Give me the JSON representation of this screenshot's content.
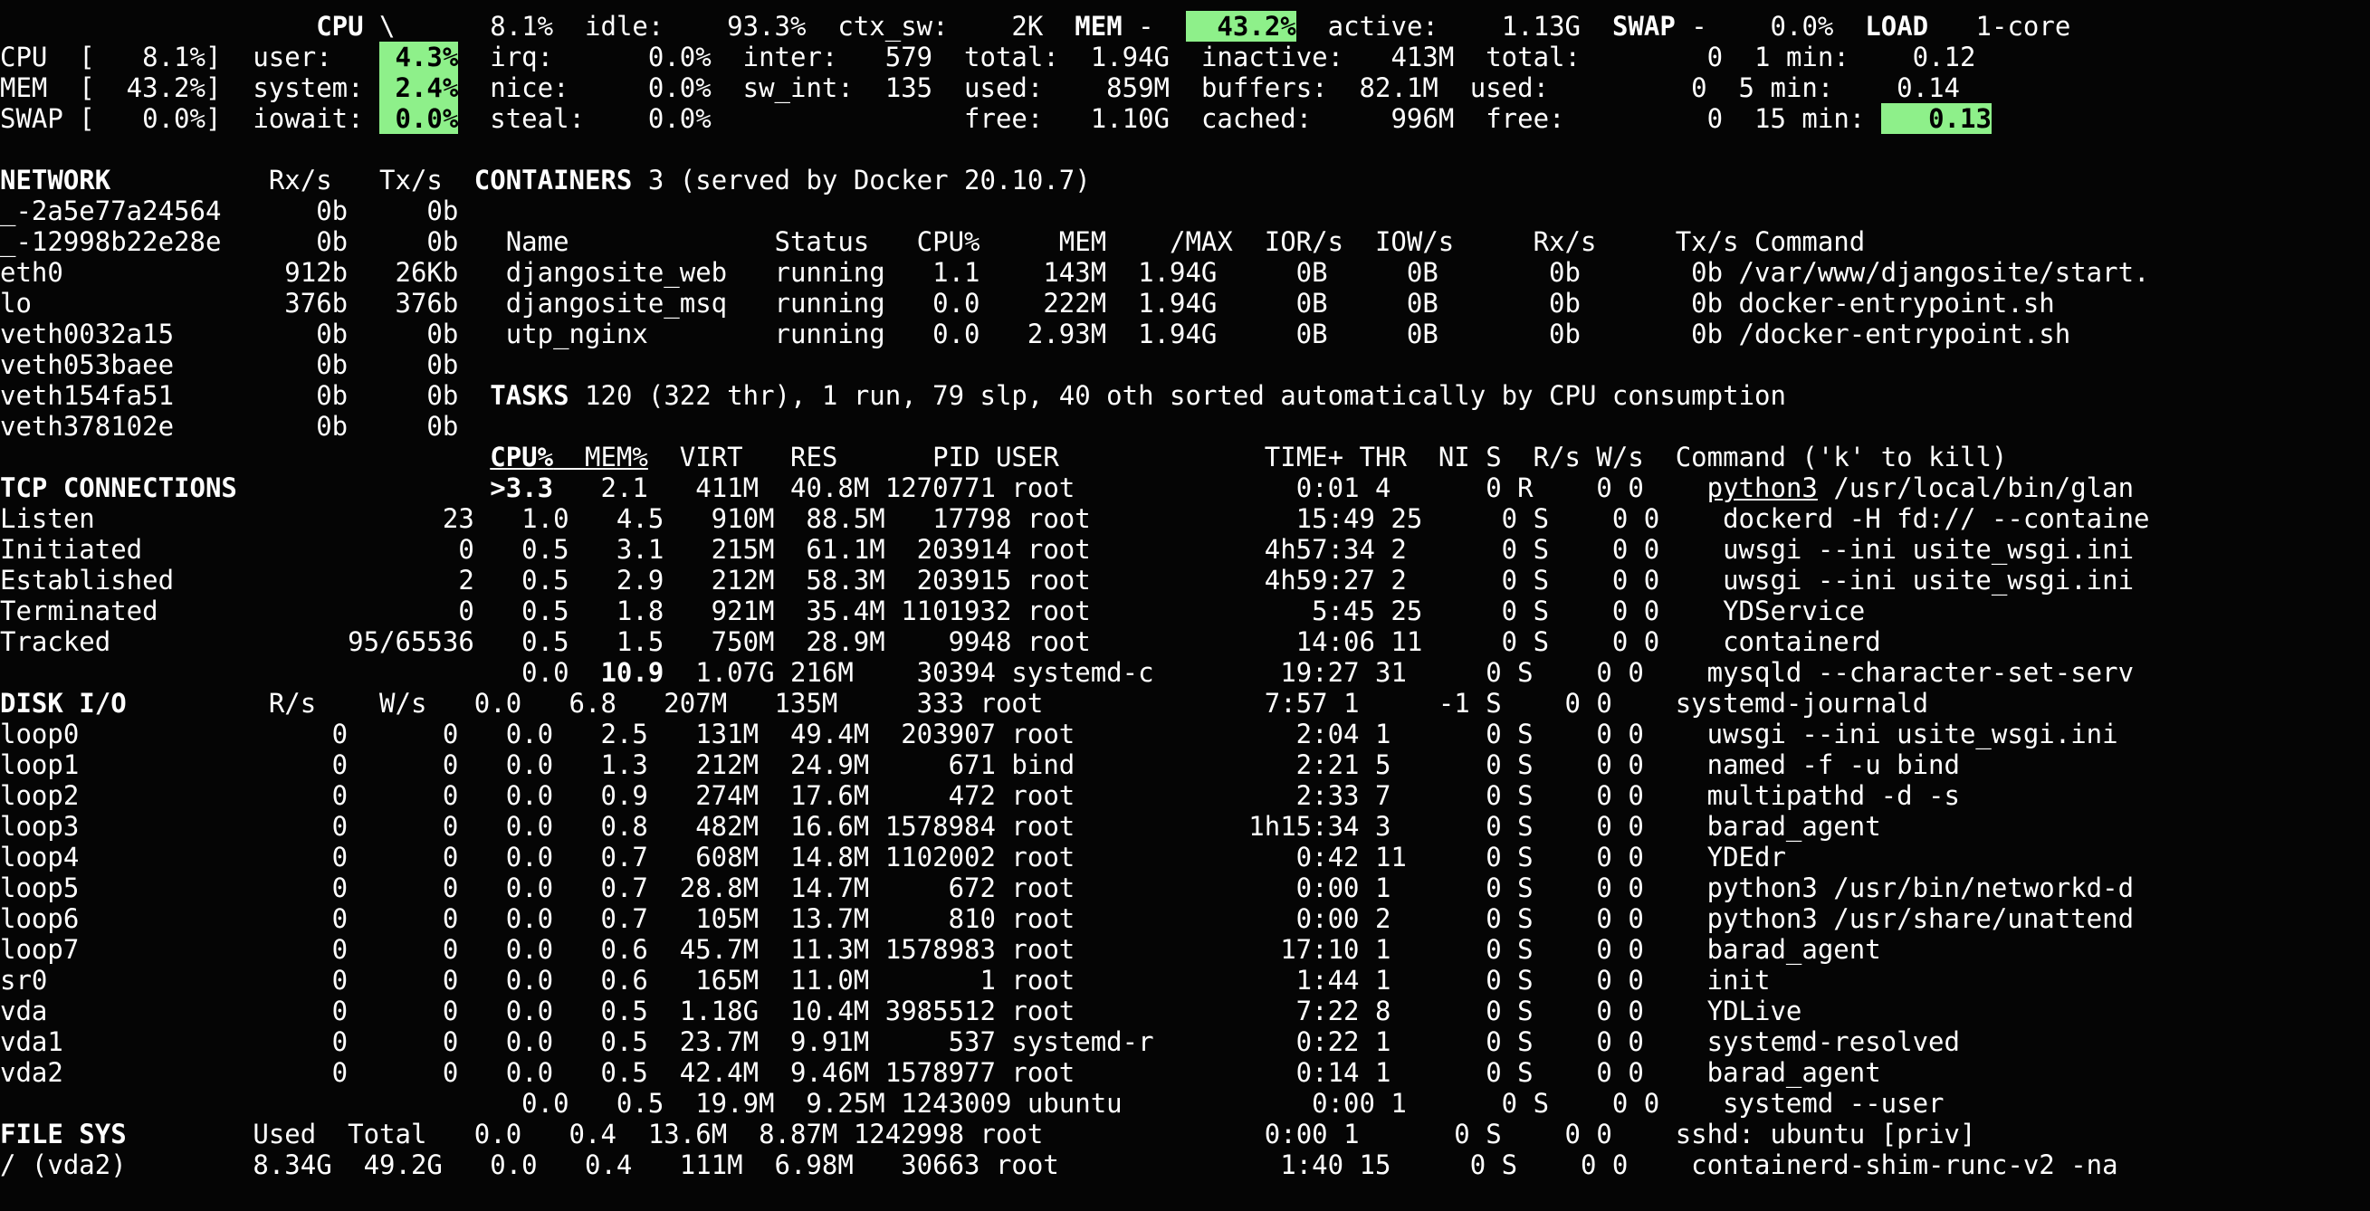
{
  "colors": {
    "background": "#050505",
    "text": "#ffffff",
    "highlight": "#8ef08a"
  },
  "lines": [
    {
      "id": "l00",
      "segs": [
        {
          "t": "                    "
        },
        {
          "t": "CPU",
          "name": "cpu-section-header",
          "c": "b"
        },
        {
          "t": " \\      8.1%  idle:    93.3%  ctx_sw:    2K  "
        },
        {
          "t": "MEM",
          "name": "mem-section-header",
          "c": "b"
        },
        {
          "t": " -  "
        },
        {
          "t": "  43.2%",
          "name": "mem-percent-value",
          "c": "hl b"
        },
        {
          "t": "  active:    1.13G  "
        },
        {
          "t": "SWAP",
          "name": "swap-section-header",
          "c": "b"
        },
        {
          "t": " -    0.0%  "
        },
        {
          "t": "LOAD",
          "name": "load-section-header",
          "c": "b"
        },
        {
          "t": "   1-core"
        }
      ]
    },
    {
      "id": "l01",
      "segs": [
        {
          "t": "CPU  [   8.1%]  user:   "
        },
        {
          "t": " 4.3%",
          "name": "cpu-user-value",
          "c": "hl b"
        },
        {
          "t": "  irq:      0.0%  inter:   579  total:  1.94G  inactive:   413M  total:        0  1 min:    0.12"
        }
      ]
    },
    {
      "id": "l02",
      "segs": [
        {
          "t": "MEM  [  43.2%]  system: "
        },
        {
          "t": " 2.4%",
          "name": "cpu-system-value",
          "c": "hl b"
        },
        {
          "t": "  nice:     0.0%  sw_int:  135  used:    859M  buffers:  82.1M  used:         0  5 min:    0.14"
        }
      ]
    },
    {
      "id": "l03",
      "segs": [
        {
          "t": "SWAP [   0.0%]  iowait: "
        },
        {
          "t": " 0.0%",
          "name": "cpu-iowait-value",
          "c": "hl b"
        },
        {
          "t": "  steal:    0.0%                free:   1.10G  cached:     996M  free:         0  15 min: "
        },
        {
          "t": "   0.13",
          "name": "load-15min-value",
          "c": "hl b"
        }
      ]
    },
    {
      "id": "l04",
      "segs": [
        {
          "t": ""
        }
      ]
    },
    {
      "id": "l05",
      "segs": [
        {
          "t": "NETWORK",
          "name": "network-section-header",
          "c": "b"
        },
        {
          "t": "          Rx/s   Tx/s  "
        },
        {
          "t": "CONTAINERS",
          "name": "containers-section-header",
          "c": "b"
        },
        {
          "t": " 3 (served by Docker 20.10.7)"
        }
      ]
    },
    {
      "id": "l06",
      "segs": [
        {
          "t": "_-2a5e77a24564      0b     0b"
        }
      ]
    },
    {
      "id": "l07",
      "segs": [
        {
          "t": "_-12998b22e28e      0b     0b   Name             Status   CPU%     MEM    /MAX  IOR/s  IOW/s     Rx/s     Tx/s Command"
        }
      ]
    },
    {
      "id": "l08",
      "segs": [
        {
          "t": "eth0              912b   26Kb   djangosite_web   running   1.1    143M  1.94G     0B     0B       0b       0b /var/www/djangosite/start."
        }
      ]
    },
    {
      "id": "l09",
      "segs": [
        {
          "t": "lo                376b   376b   djangosite_msq   running   0.0    222M  1.94G     0B     0B       0b       0b docker-entrypoint.sh"
        }
      ]
    },
    {
      "id": "l10",
      "segs": [
        {
          "t": "veth0032a15         0b     0b   utp_nginx        running   0.0   2.93M  1.94G     0B     0B       0b       0b /docker-entrypoint.sh"
        }
      ]
    },
    {
      "id": "l11",
      "segs": [
        {
          "t": "veth053baee         0b     0b"
        }
      ]
    },
    {
      "id": "l12",
      "segs": [
        {
          "t": "veth154fa51         0b     0b  "
        },
        {
          "t": "TASKS",
          "name": "tasks-section-header",
          "c": "b"
        },
        {
          "t": " 120 (322 thr), 1 run, 79 slp, 40 oth sorted automatically by CPU consumption"
        }
      ]
    },
    {
      "id": "l13",
      "segs": [
        {
          "t": "veth378102e         0b     0b"
        }
      ]
    },
    {
      "id": "l14",
      "segs": [
        {
          "t": "                               "
        },
        {
          "t": "CPU%",
          "name": "col-cpu-sort",
          "c": "b u"
        },
        {
          "t": "  MEM%",
          "c": "u"
        },
        {
          "t": "  VIRT   RES      PID USER             TIME+ THR  NI S  R/s W/s  Command ('k' to kill)"
        }
      ]
    },
    {
      "id": "l15",
      "segs": [
        {
          "t": "TCP CONNECTIONS",
          "name": "tcp-section-header",
          "c": "b"
        },
        {
          "t": "                "
        },
        {
          "t": ">3.3",
          "name": "top-cpu-value",
          "c": "b"
        },
        {
          "t": "   2.1   411M  40.8M 1270771 root              0:01 4      0 R    0 0    "
        },
        {
          "t": "python3",
          "c": "u"
        },
        {
          "t": " /usr/local/bin/glan"
        }
      ]
    },
    {
      "id": "l16",
      "segs": [
        {
          "t": "Listen                      23   1.0   4.5   910M  88.5M   17798 root             15:49 25     0 S    0 0    dockerd -H fd:// --containe"
        }
      ]
    },
    {
      "id": "l17",
      "segs": [
        {
          "t": "Initiated                    0   0.5   3.1   215M  61.1M  203914 root           4h57:34 2      0 S    0 0    uwsgi --ini usite_wsgi.ini"
        }
      ]
    },
    {
      "id": "l18",
      "segs": [
        {
          "t": "Established                  2   0.5   2.9   212M  58.3M  203915 root           4h59:27 2      0 S    0 0    uwsgi --ini usite_wsgi.ini"
        }
      ]
    },
    {
      "id": "l19",
      "segs": [
        {
          "t": "Terminated                   0   0.5   1.8   921M  35.4M 1101932 root              5:45 25     0 S    0 0    YDService"
        }
      ]
    },
    {
      "id": "l20",
      "segs": [
        {
          "t": "Tracked               95/65536   0.5   1.5   750M  28.9M    9948 root             14:06 11     0 S    0 0    containerd"
        }
      ]
    },
    {
      "id": "l21",
      "segs": [
        {
          "t": "                                 0.0  "
        },
        {
          "t": "10.9",
          "name": "top-mem-value",
          "c": "b"
        },
        {
          "t": "  1.07G 216M    30394 systemd-c        19:27 31     0 S    0 0    mysqld --character-set-serv"
        }
      ]
    },
    {
      "id": "l22",
      "segs": [
        {
          "t": "DISK I/O",
          "name": "disk-section-header",
          "c": "b"
        },
        {
          "t": "         R/s    W/s   0.0   6.8   207M   135M     333 root              7:57 1     -1 S    0 0    systemd-journald"
        }
      ]
    },
    {
      "id": "l23",
      "segs": [
        {
          "t": "loop0                0      0   0.0   2.5   131M  49.4M  203907 root              2:04 1      0 S    0 0    uwsgi --ini usite_wsgi.ini"
        }
      ]
    },
    {
      "id": "l24",
      "segs": [
        {
          "t": "loop1                0      0   0.0   1.3   212M  24.9M     671 bind              2:21 5      0 S    0 0    named -f -u bind"
        }
      ]
    },
    {
      "id": "l25",
      "segs": [
        {
          "t": "loop2                0      0   0.0   0.9   274M  17.6M     472 root              2:33 7      0 S    0 0    multipathd -d -s"
        }
      ]
    },
    {
      "id": "l26",
      "segs": [
        {
          "t": "loop3                0      0   0.0   0.8   482M  16.6M 1578984 root           1h15:34 3      0 S    0 0    barad_agent"
        }
      ]
    },
    {
      "id": "l27",
      "segs": [
        {
          "t": "loop4                0      0   0.0   0.7   608M  14.8M 1102002 root              0:42 11     0 S    0 0    YDEdr"
        }
      ]
    },
    {
      "id": "l28",
      "segs": [
        {
          "t": "loop5                0      0   0.0   0.7  28.8M  14.7M     672 root              0:00 1      0 S    0 0    python3 /usr/bin/networkd-d"
        }
      ]
    },
    {
      "id": "l29",
      "segs": [
        {
          "t": "loop6                0      0   0.0   0.7   105M  13.7M     810 root              0:00 2      0 S    0 0    python3 /usr/share/unattend"
        }
      ]
    },
    {
      "id": "l30",
      "segs": [
        {
          "t": "loop7                0      0   0.0   0.6  45.7M  11.3M 1578983 root             17:10 1      0 S    0 0    barad_agent"
        }
      ]
    },
    {
      "id": "l31",
      "segs": [
        {
          "t": "sr0                  0      0   0.0   0.6   165M  11.0M       1 root              1:44 1      0 S    0 0    init"
        }
      ]
    },
    {
      "id": "l32",
      "segs": [
        {
          "t": "vda                  0      0   0.0   0.5  1.18G  10.4M 3985512 root              7:22 8      0 S    0 0    YDLive"
        }
      ]
    },
    {
      "id": "l33",
      "segs": [
        {
          "t": "vda1                 0      0   0.0   0.5  23.7M  9.91M     537 systemd-r         0:22 1      0 S    0 0    systemd-resolved"
        }
      ]
    },
    {
      "id": "l34",
      "segs": [
        {
          "t": "vda2                 0      0   0.0   0.5  42.4M  9.46M 1578977 root              0:14 1      0 S    0 0    barad_agent"
        }
      ]
    },
    {
      "id": "l35",
      "segs": [
        {
          "t": "                                 0.0   0.5  19.9M  9.25M 1243009 ubuntu            0:00 1      0 S    0 0    systemd --user"
        }
      ]
    },
    {
      "id": "l36",
      "segs": [
        {
          "t": "FILE SYS",
          "name": "filesys-section-header",
          "c": "b"
        },
        {
          "t": "        Used  Total   0.0   0.4  13.6M  8.87M 1242998 root              0:00 1      0 S    0 0    sshd: ubuntu [priv]"
        }
      ]
    },
    {
      "id": "l37",
      "segs": [
        {
          "t": "/ (vda2)        8.34G  49.2G   0.0   0.4   111M  6.98M   30663 root              1:40 15     0 S    0 0    containerd-shim-runc-v2 -na"
        }
      ]
    }
  ]
}
